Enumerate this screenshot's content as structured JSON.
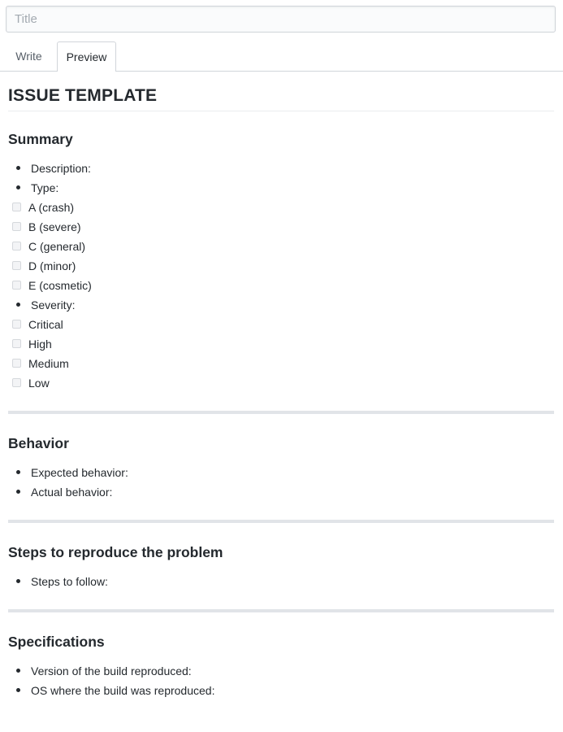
{
  "title_field": {
    "placeholder": "Title",
    "value": ""
  },
  "tabs": [
    {
      "label": "Write"
    },
    {
      "label": "Preview"
    }
  ],
  "active_tab": "Preview",
  "document": {
    "heading": "ISSUE TEMPLATE",
    "sections": [
      {
        "title": "Summary",
        "items": [
          {
            "label": "Description:"
          },
          {
            "label": "Type:",
            "checkboxes": [
              {
                "label": "A (crash)",
                "checked": false
              },
              {
                "label": "B (severe)",
                "checked": false
              },
              {
                "label": "C (general)",
                "checked": false
              },
              {
                "label": "D (minor)",
                "checked": false
              },
              {
                "label": "E (cosmetic)",
                "checked": false
              }
            ]
          },
          {
            "label": "Severity:",
            "checkboxes": [
              {
                "label": "Critical",
                "checked": false
              },
              {
                "label": "High",
                "checked": false
              },
              {
                "label": "Medium",
                "checked": false
              },
              {
                "label": "Low",
                "checked": false
              }
            ]
          }
        ]
      },
      {
        "title": "Behavior",
        "items": [
          {
            "label": "Expected behavior:"
          },
          {
            "label": "Actual behavior:"
          }
        ]
      },
      {
        "title": "Steps to reproduce the problem",
        "items": [
          {
            "label": "Steps to follow:"
          }
        ]
      },
      {
        "title": "Specifications",
        "items": [
          {
            "label": "Version of the build reproduced:"
          },
          {
            "label": "OS where the build was reproduced:"
          }
        ]
      }
    ]
  }
}
